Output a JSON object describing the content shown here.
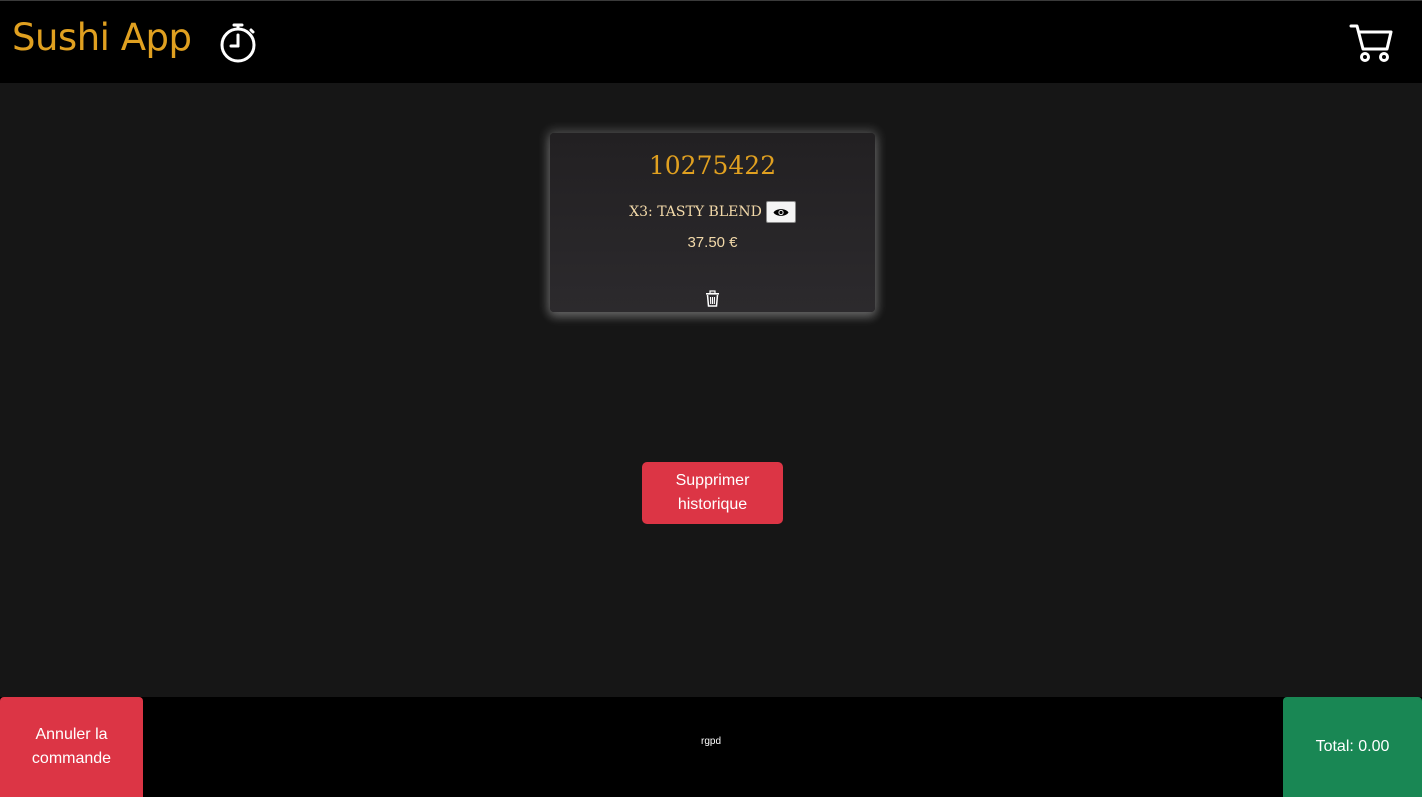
{
  "header": {
    "app_title": "Sushi App",
    "timer_icon": "stopwatch-icon",
    "cart_icon": "shopping-cart-icon"
  },
  "order_card": {
    "order_number": "10275422",
    "item_text": "X3: TASTY BLEND",
    "view_icon": "eye-icon",
    "price": "37.50 €",
    "delete_icon": "trash-icon"
  },
  "main": {
    "clear_history_label": "Supprimer historique"
  },
  "footer": {
    "cancel_order_label": "Annuler la commande",
    "rgpd_label": "rgpd",
    "total_label": "Total: 0.00"
  },
  "colors": {
    "accent_gold": "#e0a020",
    "danger_red": "#dc3545",
    "success_green": "#198754",
    "background": "#161616",
    "bar_black": "#000000"
  }
}
